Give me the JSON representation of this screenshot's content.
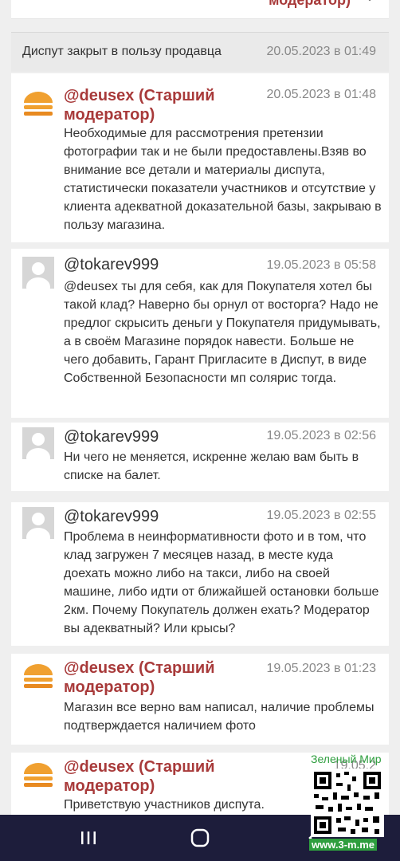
{
  "top_strip": {
    "cut_label": "модератор)"
  },
  "status": {
    "text": "Диспут закрыт в пользу продавца",
    "date": "20.05.2023 в 01:49"
  },
  "posts": [
    {
      "author": "@deusex (Старший модератор)",
      "role": "moderator",
      "date": "20.05.2023 в 01:48",
      "message": "Необходимые для рассмотрения претензии фотографии так и не были предоставлены.Взяв во внимание все детали и материалы диспута, статистически показатели участников и отсутствие у клиента адекватной доказательной базы, закрываю в пользу магазина."
    },
    {
      "author": "@tokarev999",
      "role": "user",
      "date": "19.05.2023 в 05:58",
      "message": "@deusex ты для себя, как для Покупателя хотел бы такой клад? Наверно бы орнул от восторга? Надо не предлог скрысить деньги у Покупателя придумывать, а в своём Магазине порядок навести. Больше не чего добавить, Гарант Пригласите в Диспут, в виде Собственной Безопасности мп солярис тогда."
    },
    {
      "author": "@tokarev999",
      "role": "user",
      "date": "19.05.2023 в 02:56",
      "message": "Ни чего не меняется, искренне желаю вам быть в списке на балет."
    },
    {
      "author": "@tokarev999",
      "role": "user",
      "date": "19.05.2023 в 02:55",
      "message": "Проблема в неинформативности фото и в том, что клад загружен 7 месяцев назад, в месте куда доехать можно либо на такси, либо на своей машине, либо идти от ближайшей остановки больше 2км. Почему Покупатель должен ехать? Модератор вы адекватный? Или крысы?"
    },
    {
      "author": "@deusex (Старший модератор)",
      "role": "moderator",
      "date": "19.05.2023 в 01:23",
      "message": "Магазин все верно вам написал, наличие проблемы подтверждается наличием фото"
    },
    {
      "author": "@deusex (Старший модератор)",
      "role": "moderator",
      "date": "19.05.2",
      "message": "Приветствую участников диспута."
    }
  ],
  "watermark": {
    "title": "Зеленый Мир",
    "url": "www.3-m.me"
  },
  "colors": {
    "moderator_name": "#a83a3a",
    "text": "#333333",
    "date": "#888888",
    "navbar": "#1d1d3b",
    "logo_orange": "#f0a030"
  },
  "navbar": {
    "icons": [
      "recent-apps-icon",
      "home-icon",
      "back-icon"
    ]
  }
}
